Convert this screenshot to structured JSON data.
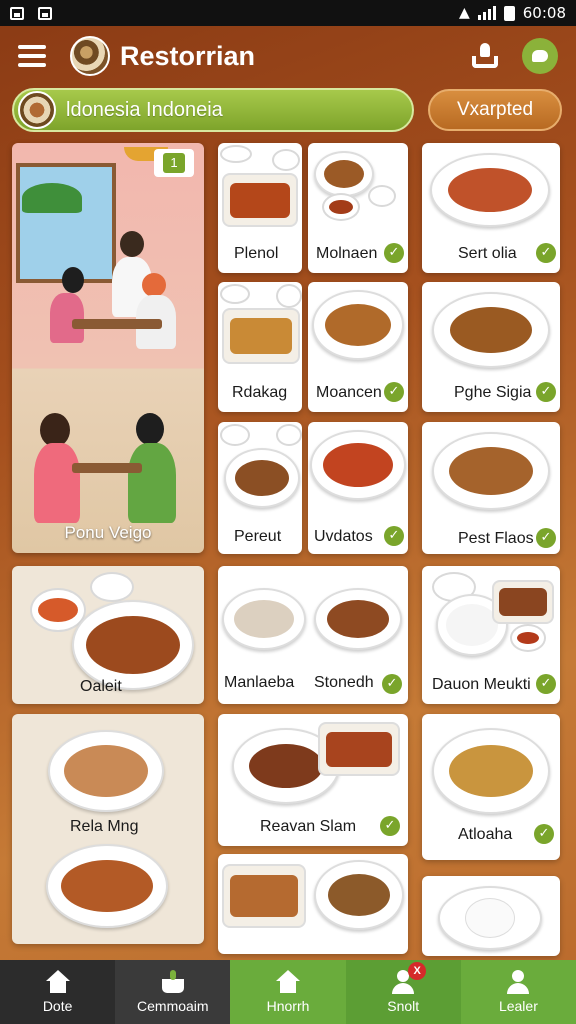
{
  "status_bar": {
    "time": "60:08"
  },
  "app_bar": {
    "title": "Restorrian"
  },
  "search": {
    "value": "ldonesia Indoneia"
  },
  "filter": {
    "label": "Vxarpted"
  },
  "scene": {
    "badge": "1",
    "label": "Ponu Veigo"
  },
  "cards": {
    "plenol": "Plenol",
    "molnaen": "Molnaen",
    "sertolia": "Sert olia",
    "rdakag": "Rdakag",
    "moancen": "Moancen",
    "pghe_sigia": "Pghe Sigia",
    "pereut": "Pereut",
    "uvdatos": "Uvdatos",
    "pest_flaos": "Pest Flaos",
    "oaleit": "Oaleit",
    "manlaeba": "Manlaeba",
    "stonedh": "Stonedh",
    "dauon_meukti": "Dauon Meukti",
    "rela_mng": "Rela Mng",
    "reavan_slam": "Reavan Slam",
    "atloaha": "Atloaha"
  },
  "bottom_nav": {
    "items": [
      {
        "label": "Dote",
        "icon": "home-icon"
      },
      {
        "label": "Cemmoaim",
        "icon": "basket-icon"
      },
      {
        "label": "Hnorrh",
        "icon": "home-icon"
      },
      {
        "label": "Snolt",
        "icon": "people-icon",
        "badge": "X"
      },
      {
        "label": "Lealer",
        "icon": "user-icon"
      }
    ]
  },
  "colors": {
    "background": "#a5501e",
    "accent_green": "#7aa52b",
    "accent_orange": "#c97a2e",
    "nav_dark": "#2c2c2c",
    "nav_green": "#6aac3c"
  }
}
